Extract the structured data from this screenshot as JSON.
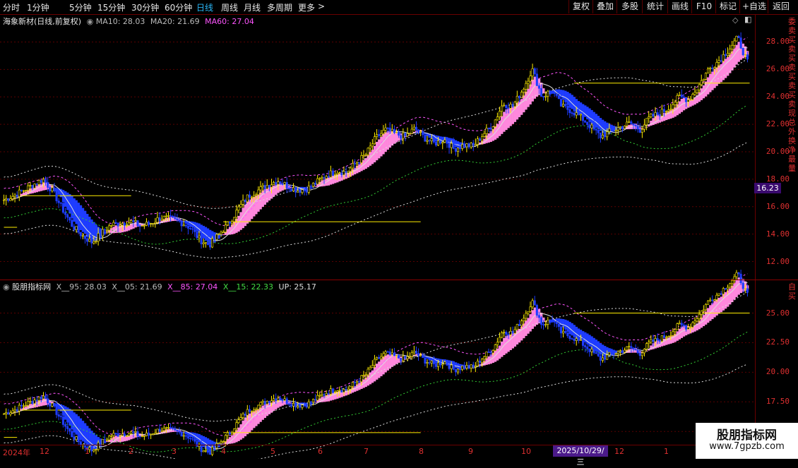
{
  "toolbar": {
    "timeframes": [
      "分时",
      "1分钟",
      "5分钟",
      "15分钟",
      "30分钟",
      "60分钟",
      "日线",
      "周线",
      "月线",
      "多周期",
      "更多"
    ],
    "active": "日线",
    "more_arrow": ">",
    "right_buttons": [
      "复权",
      "叠加",
      "多股",
      "统计",
      "画线",
      "F10",
      "标记",
      "+自选",
      "返回"
    ]
  },
  "main_panel": {
    "stock_title": "海象新材(日线,前复权)",
    "indicators": [
      {
        "label": "MA10: 28.03",
        "color": "#bbbbbb"
      },
      {
        "label": "MA20: 21.69",
        "color": "#bbbbbb"
      },
      {
        "label": "MA60: 27.04",
        "color": "#ff55ff"
      }
    ],
    "y_ticks": [
      "28.00",
      "26.00",
      "24.00",
      "22.00",
      "20.00",
      "18.00",
      "16.00",
      "14.00",
      "12.00"
    ],
    "current_price": "16.23",
    "side_text": "委卖买卖买卖买卖买卖现总外换净最量"
  },
  "sub_panel": {
    "title": "股朋指标网",
    "indicators": [
      {
        "label": "X__95: 28.03",
        "color": "#bbbbbb"
      },
      {
        "label": "X__05: 21.69",
        "color": "#bbbbbb"
      },
      {
        "label": "X__85: 27.04",
        "color": "#ff55ff"
      },
      {
        "label": "X__15: 22.33",
        "color": "#44dd44"
      },
      {
        "label": "UP: 25.17",
        "color": "#dddddd"
      }
    ],
    "y_ticks": [
      "25.00",
      "22.50",
      "20.00",
      "17.50",
      "15.00"
    ],
    "side_text": "自买"
  },
  "date_axis": {
    "labels": [
      "2024年",
      "12",
      "1",
      "2",
      "3",
      "4",
      "5",
      "6",
      "7",
      "8",
      "9",
      "10",
      "12",
      "1"
    ],
    "cursor_date": "2025/10/29/三"
  },
  "watermark": {
    "line1": "股朋指标网",
    "line2": "www.7gpzb.com"
  },
  "colors": {
    "up": "#ffee00",
    "down": "#1e3cff",
    "band": "#ff88dd",
    "ma60": "#ff55ff",
    "green": "#33cc33",
    "white": "#dddddd",
    "grid": "#5a0000"
  },
  "chart_data": {
    "type": "candlestick",
    "y_range_main": [
      11,
      29
    ],
    "y_range_sub": [
      14,
      27
    ],
    "close_path": [
      16.5,
      16.8,
      17.2,
      17.6,
      18.0,
      17.1,
      15.8,
      14.6,
      13.9,
      13.4,
      14.1,
      14.7,
      14.8,
      14.9,
      14.6,
      14.8,
      15.2,
      15.1,
      14.9,
      14.5,
      13.6,
      13.2,
      14.0,
      14.8,
      15.9,
      16.8,
      17.2,
      17.6,
      17.9,
      17.5,
      17.2,
      17.3,
      17.8,
      18.3,
      18.6,
      18.5,
      19.2,
      19.8,
      21.0,
      21.6,
      21.3,
      21.1,
      21.7,
      21.0,
      20.6,
      20.9,
      20.2,
      20.5,
      20.4,
      21.3,
      22.0,
      23.5,
      23.3,
      24.5,
      26.0,
      24.0,
      24.5,
      23.3,
      23.0,
      22.5,
      21.8,
      21.1,
      21.5,
      21.8,
      22.1,
      21.6,
      22.5,
      22.8,
      23.2,
      24.0,
      23.8,
      24.8,
      26.0,
      26.6,
      27.4,
      28.3,
      26.5
    ],
    "annotations": [
      "16.23",
      "2025/10/29/三"
    ]
  }
}
